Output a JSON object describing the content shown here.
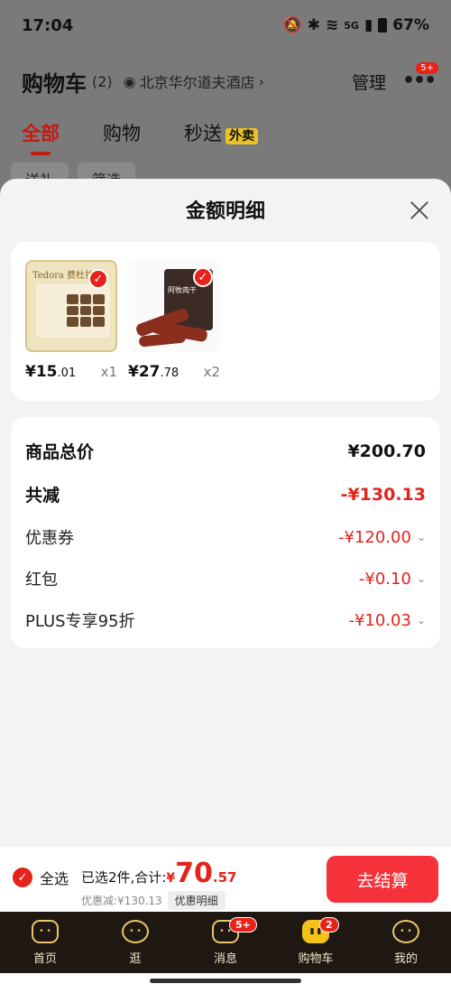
{
  "status": {
    "time": "17:04",
    "battery": "67%",
    "network": "5G"
  },
  "cart_header": {
    "title": "购物车",
    "count": "(2)",
    "location": "北京华尔道夫酒店",
    "manage": "管理",
    "more_badge": "5+"
  },
  "cart_tabs": [
    {
      "label": "全部",
      "active": true
    },
    {
      "label": "购物"
    },
    {
      "label": "秒送",
      "badge": "外卖"
    }
  ],
  "filters": [
    "送礼",
    "筛选"
  ],
  "sheet": {
    "title": "金额明细",
    "products": [
      {
        "brand": "Tedora 费杜拉",
        "price_int": "¥15",
        "price_dec": ".01",
        "qty": "x1"
      },
      {
        "brand": "阿牧肉干",
        "price_int": "¥27",
        "price_dec": ".78",
        "qty": "x2"
      }
    ],
    "summary": {
      "total_label": "商品总价",
      "total_value": "¥200.70",
      "reduce_label": "共减",
      "reduce_value": "-¥130.13",
      "coupon_label": "优惠券",
      "coupon_value": "-¥120.00",
      "redpacket_label": "红包",
      "redpacket_value": "-¥0.10",
      "plus_label": "PLUS专享95折",
      "plus_value": "-¥10.03"
    }
  },
  "checkout": {
    "select_all": "全选",
    "selected_text": "已选2件,合计:",
    "currency": "¥",
    "amount_int": "70",
    "amount_dec": ".57",
    "discount_text": "优惠减:¥130.13",
    "detail_label": "优惠明细",
    "button": "去结算"
  },
  "nav": [
    {
      "label": "首页"
    },
    {
      "label": "逛"
    },
    {
      "label": "消息",
      "badge": "5+"
    },
    {
      "label": "购物车",
      "badge": "2",
      "active": true
    },
    {
      "label": "我的"
    }
  ],
  "colors": {
    "accent": "#e5231a",
    "checkout": "#f5323a",
    "tabbar": "#1f1812",
    "nav_active": "#f4c21b"
  }
}
